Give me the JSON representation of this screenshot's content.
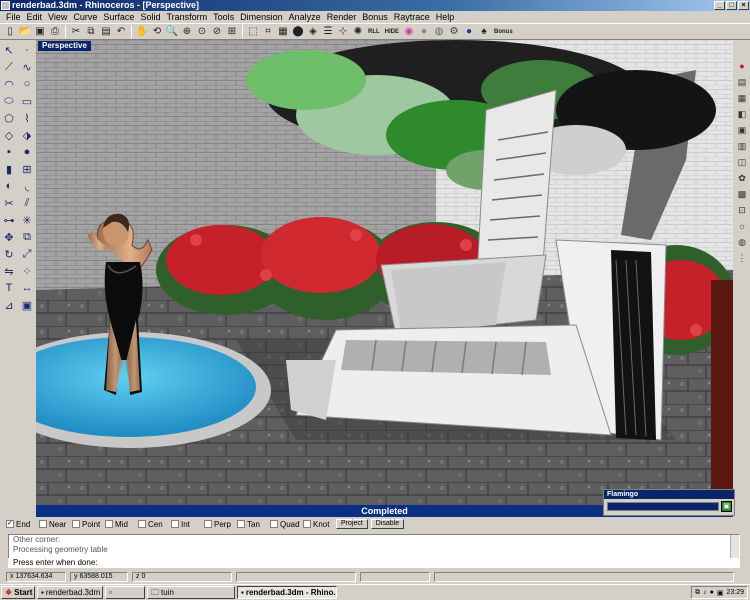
{
  "window": {
    "title": "renderbad.3dm - Rhinoceros - [Perspective]"
  },
  "menu": [
    "File",
    "Edit",
    "View",
    "Curve",
    "Surface",
    "Solid",
    "Transform",
    "Tools",
    "Dimension",
    "Analyze",
    "Render",
    "Bonus",
    "Raytrace",
    "Help"
  ],
  "toolbar": {
    "rll_label": "RLL",
    "hide_label": "HIDE",
    "bonus_label": "Bonus"
  },
  "viewport": {
    "label": "Perspective"
  },
  "render": {
    "completed_label": "Completed"
  },
  "flamingo": {
    "title": "Flamingo",
    "progress": 1.0
  },
  "osnap": {
    "items": [
      "End",
      "Near",
      "Point",
      "Mid",
      "Cen",
      "Int",
      "Perp",
      "Tan",
      "Quad",
      "Knot"
    ],
    "checked": [
      true,
      false,
      false,
      false,
      false,
      false,
      false,
      false,
      false,
      false
    ],
    "project_label": "Project",
    "disable_label": "Disable"
  },
  "command": {
    "history": [
      "Other corner:",
      "Processing geometry table"
    ],
    "prompt": "Press enter when done:"
  },
  "status": {
    "x": "x 137634.634",
    "y": "y 63588.015",
    "z": "z 0"
  },
  "taskbar": {
    "start": "Start",
    "tasks": [
      "renderbad.3dm - Rhin...",
      "",
      "tuin",
      "renderbad.3dm - Rhino..."
    ],
    "clock": "23:29"
  },
  "colors": {
    "titlebar": "#0a246a",
    "completed_bar": "#0b2f83",
    "pool": "#25a4d6",
    "wall": "#9c9c9c",
    "flowers": "#c6202a",
    "leaves": "#2f8a2e"
  }
}
